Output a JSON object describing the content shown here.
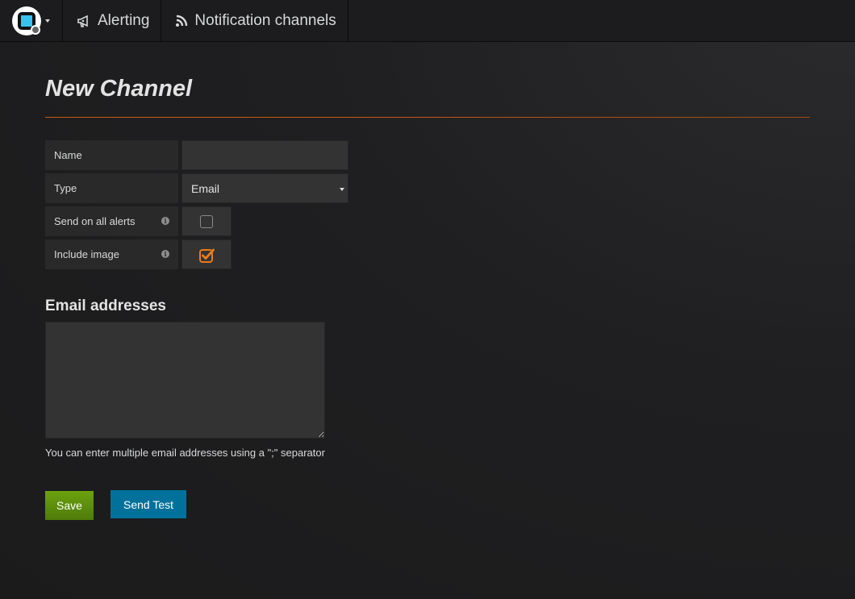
{
  "navbar": {
    "logo_icon": "grafana-logo-icon",
    "tabs": [
      {
        "label": "Alerting",
        "icon": "megaphone-icon"
      },
      {
        "label": "Notification channels",
        "icon": "rss-icon"
      }
    ]
  },
  "page": {
    "title": "New Channel",
    "accent_color": "#c55a11"
  },
  "form": {
    "name": {
      "label": "Name",
      "value": "",
      "placeholder": ""
    },
    "type": {
      "label": "Type",
      "selected": "Email"
    },
    "send_on_all_alerts": {
      "label": "Send on all alerts",
      "checked": false
    },
    "include_image": {
      "label": "Include image",
      "checked": true,
      "check_color": "#eb7b18"
    }
  },
  "email": {
    "heading": "Email addresses",
    "value": "",
    "help": "You can enter multiple email addresses using a \";\" separator"
  },
  "buttons": {
    "save_label": "Save",
    "save_color": "#629e10",
    "test_label": "Send Test",
    "test_color": "#00719a"
  }
}
